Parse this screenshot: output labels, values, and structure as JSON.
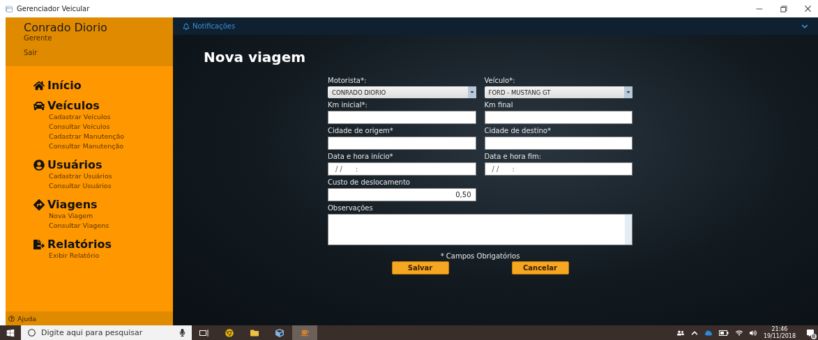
{
  "window": {
    "title": "Gerenciador Veicular"
  },
  "sidebar": {
    "user_name": "Conrado Diorio",
    "role": "Gerente",
    "logout": "Sair",
    "help": "Ajuda",
    "sections": [
      {
        "title": "Início"
      },
      {
        "title": "Veículos",
        "items": [
          "Cadastrar Veículos",
          "Consultar Veículos",
          "Cadastrar Manutenção",
          "Consultar Manutenção"
        ]
      },
      {
        "title": "Usuários",
        "items": [
          "Cadastrar Usuários",
          "Consultar Usuários"
        ]
      },
      {
        "title": "Viagens",
        "items": [
          "Nova Viagem",
          "Consultar Viagens"
        ]
      },
      {
        "title": "Relatórios",
        "items": [
          "Exibir Relatório"
        ]
      }
    ]
  },
  "header": {
    "notifications": "Notificações"
  },
  "form": {
    "title": "Nova viagem",
    "fields": [
      {
        "kind": "select",
        "label": "Motorista*:",
        "value": "CONRADO DIORIO"
      },
      {
        "kind": "select",
        "label": "Veículo*:",
        "value": "FORD - MUSTANG GT"
      },
      {
        "kind": "text",
        "label": "Km inicial*:"
      },
      {
        "kind": "text",
        "label": "Km final"
      },
      {
        "kind": "text",
        "label": "Cidade de origem*"
      },
      {
        "kind": "text",
        "label": "Cidade de destino*"
      },
      {
        "kind": "mask",
        "label": "Data e hora início*",
        "value": "/ /      :"
      },
      {
        "kind": "mask",
        "label": "Data e hora fim:",
        "value": "/ /      :"
      },
      {
        "kind": "number",
        "label": "Custo de deslocamento",
        "value": "0,50"
      },
      {
        "kind": "textarea",
        "label": "Observações"
      }
    ],
    "required_note": "* Campos Obrigatórios",
    "buttons": [
      "Salvar",
      "Cancelar"
    ]
  },
  "taskbar": {
    "search_placeholder": "Digite aqui para pesquisar",
    "apps": [
      {
        "kind": "chrome",
        "selected": false
      },
      {
        "kind": "folder",
        "selected": false
      },
      {
        "kind": "cube",
        "selected": false
      },
      {
        "kind": "java",
        "selected": true
      }
    ],
    "time": "21:46",
    "date": "19/11/2018",
    "notification_count": "8"
  }
}
